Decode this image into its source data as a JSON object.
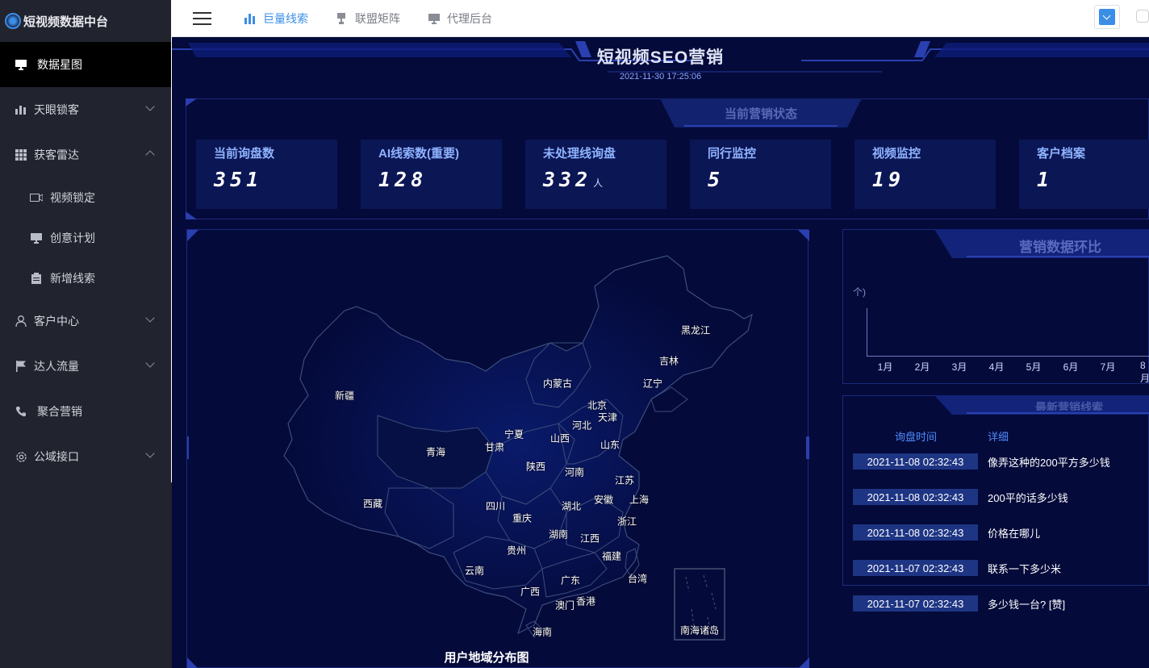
{
  "app": {
    "title": "短视频数据中台"
  },
  "sidebar": {
    "items": [
      {
        "label": "数据星图",
        "icon": "monitor-icon"
      },
      {
        "label": "天眼锁客",
        "icon": "bar-chart-icon"
      },
      {
        "label": "获客雷达",
        "icon": "grid-icon"
      },
      {
        "label": "客户中心",
        "icon": "user-icon"
      },
      {
        "label": "达人流量",
        "icon": "flag-icon"
      },
      {
        "label": "聚合营销",
        "icon": "phone-icon"
      },
      {
        "label": "公域接口",
        "icon": "gear-icon"
      }
    ],
    "sub_items": [
      {
        "label": "视频锁定",
        "icon": "video-camera-icon"
      },
      {
        "label": "创意计划",
        "icon": "monitor-icon"
      },
      {
        "label": "新增线索",
        "icon": "clipboard-icon"
      }
    ]
  },
  "topnav": {
    "items": [
      {
        "label": "巨量线索",
        "icon": "bar-chart-icon",
        "active": true
      },
      {
        "label": "联盟矩阵",
        "icon": "stamp-icon",
        "active": false
      },
      {
        "label": "代理后台",
        "icon": "monitor-icon",
        "active": false
      }
    ]
  },
  "dashboard": {
    "title": "短视频SEO营销",
    "datetime": "2021-11-30 17:25:06",
    "status_title": "当前营销状态",
    "stats": [
      {
        "label": "当前询盘数",
        "value": "351",
        "unit": ""
      },
      {
        "label": "AI线索数(重要)",
        "value": "128",
        "unit": ""
      },
      {
        "label": "未处理线询盘",
        "value": "332",
        "unit": "人"
      },
      {
        "label": "同行监控",
        "value": "5",
        "unit": ""
      },
      {
        "label": "视频监控",
        "value": "19",
        "unit": ""
      },
      {
        "label": "客户档案",
        "value": "1",
        "unit": ""
      }
    ],
    "map": {
      "title": "用户地域分布图",
      "provinces": [
        "黑龙江",
        "吉林",
        "辽宁",
        "内蒙古",
        "北京",
        "天津",
        "河北",
        "山西",
        "山东",
        "宁夏",
        "甘肃",
        "青海",
        "新疆",
        "陕西",
        "河南",
        "江苏",
        "上海",
        "安徽",
        "湖北",
        "四川",
        "重庆",
        "西藏",
        "浙江",
        "湖南",
        "江西",
        "贵州",
        "福建",
        "云南",
        "广东",
        "台湾",
        "广西",
        "香港",
        "澳门",
        "海南",
        "南海诸岛"
      ]
    },
    "marketing_chart": {
      "title": "营销数据环比",
      "unit_label": "个)"
    },
    "leads": {
      "title": "最新营销线索",
      "col_time": "询盘时间",
      "col_detail": "详细",
      "rows": [
        {
          "time": "2021-11-08 02:32:43",
          "detail": "像弄这种的200平方多少钱"
        },
        {
          "time": "2021-11-08 02:32:43",
          "detail": "200平的话多少钱"
        },
        {
          "time": "2021-11-08 02:32:43",
          "detail": "价格在哪儿"
        },
        {
          "time": "2021-11-07 02:32:43",
          "detail": "联系一下多少米"
        },
        {
          "time": "2021-11-07 02:32:43",
          "detail": "多少钱一台? [赞]"
        }
      ]
    }
  },
  "chart_data": {
    "type": "line",
    "title": "营销数据环比",
    "ylabel": "个)",
    "categories": [
      "1月",
      "2月",
      "3月",
      "4月",
      "5月",
      "6月",
      "7月",
      "8月"
    ],
    "series": []
  }
}
